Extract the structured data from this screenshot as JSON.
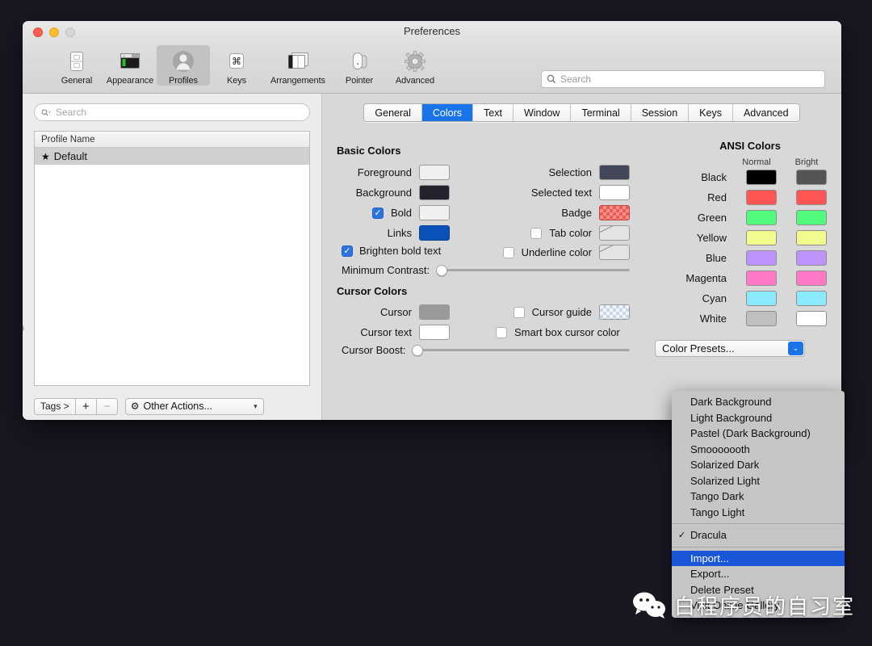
{
  "window": {
    "title": "Preferences",
    "traffic_lights": [
      "close",
      "minimize",
      "zoom-disabled"
    ]
  },
  "toolbar": {
    "items": [
      {
        "label": "General",
        "icon": "general-icon"
      },
      {
        "label": "Appearance",
        "icon": "appearance-icon"
      },
      {
        "label": "Profiles",
        "icon": "profiles-icon",
        "selected": true
      },
      {
        "label": "Keys",
        "icon": "keys-icon"
      },
      {
        "label": "Arrangements",
        "icon": "arrangements-icon"
      },
      {
        "label": "Pointer",
        "icon": "pointer-icon"
      },
      {
        "label": "Advanced",
        "icon": "advanced-icon"
      }
    ],
    "search_placeholder": "Search"
  },
  "sidebar": {
    "search_placeholder": "Search",
    "column_header": "Profile Name",
    "profiles": [
      {
        "name": "Default",
        "starred": true,
        "selected": true
      }
    ],
    "footer": {
      "tags_label": "Tags >",
      "add_label": "+",
      "remove_label": "−",
      "other_actions_label": "Other Actions...",
      "gear_icon": "gear-icon",
      "chevron_icon": "chevron-down-icon"
    }
  },
  "tabs": [
    {
      "label": "General",
      "active": false
    },
    {
      "label": "Colors",
      "active": true
    },
    {
      "label": "Text",
      "active": false
    },
    {
      "label": "Window",
      "active": false
    },
    {
      "label": "Terminal",
      "active": false
    },
    {
      "label": "Session",
      "active": false
    },
    {
      "label": "Keys",
      "active": false
    },
    {
      "label": "Advanced",
      "active": false
    }
  ],
  "basic_colors": {
    "title": "Basic Colors",
    "left": [
      {
        "label": "Foreground",
        "color": "#f0f0f0",
        "checkbox": null
      },
      {
        "label": "Background",
        "color": "#23222d",
        "checkbox": null
      },
      {
        "label": "Bold",
        "color": "#f0f0f0",
        "checkbox": true
      },
      {
        "label": "Links",
        "color": "#0b52b8",
        "checkbox": null
      }
    ],
    "right": [
      {
        "label": "Selection",
        "color": "#44475a",
        "checkbox": null
      },
      {
        "label": "Selected text",
        "color": "#ffffff",
        "checkbox": null
      },
      {
        "label": "Badge",
        "color": "#ff5555",
        "checkbox": null,
        "style": "badge"
      },
      {
        "label": "Tab color",
        "color": null,
        "checkbox": false,
        "style": "empty"
      }
    ],
    "brighten_bold_text": {
      "label": "Brighten bold text",
      "checked": true
    },
    "underline_color": {
      "label": "Underline color",
      "checked": false,
      "style": "empty"
    },
    "minimum_contrast": {
      "label": "Minimum Contrast:",
      "value": 0
    }
  },
  "cursor_colors": {
    "title": "Cursor Colors",
    "left": [
      {
        "label": "Cursor",
        "color": "#9a9a9a"
      },
      {
        "label": "Cursor text",
        "color": "#ffffff"
      }
    ],
    "right": [
      {
        "label": "Cursor guide",
        "checked": false,
        "style": "checker"
      },
      {
        "label": "Smart box cursor color",
        "checked": false
      }
    ],
    "cursor_boost": {
      "label": "Cursor Boost:",
      "value": 0
    }
  },
  "ansi_colors": {
    "title": "ANSI Colors",
    "columns": [
      "Normal",
      "Bright"
    ],
    "rows": [
      {
        "name": "Black",
        "normal": "#000000",
        "bright": "#555555"
      },
      {
        "name": "Red",
        "normal": "#ff5555",
        "bright": "#ff5555"
      },
      {
        "name": "Green",
        "normal": "#50fa7b",
        "bright": "#50fa7b"
      },
      {
        "name": "Yellow",
        "normal": "#f1fa8c",
        "bright": "#f1fa8c"
      },
      {
        "name": "Blue",
        "normal": "#bd93f9",
        "bright": "#bd93f9"
      },
      {
        "name": "Magenta",
        "normal": "#ff79c6",
        "bright": "#ff79c6"
      },
      {
        "name": "Cyan",
        "normal": "#8be9fd",
        "bright": "#8be9fd"
      },
      {
        "name": "White",
        "normal": "#bfbfbf",
        "bright": "#ffffff"
      }
    ]
  },
  "color_presets": {
    "button_label": "Color Presets...",
    "menu_items": [
      {
        "label": "Dark Background",
        "checked": false,
        "highlighted": false
      },
      {
        "label": "Light Background",
        "checked": false,
        "highlighted": false
      },
      {
        "label": "Pastel (Dark Background)",
        "checked": false,
        "highlighted": false
      },
      {
        "label": "Smooooooth",
        "checked": false,
        "highlighted": false
      },
      {
        "label": "Solarized Dark",
        "checked": false,
        "highlighted": false
      },
      {
        "label": "Solarized Light",
        "checked": false,
        "highlighted": false
      },
      {
        "label": "Tango Dark",
        "checked": false,
        "highlighted": false
      },
      {
        "label": "Tango Light",
        "checked": false,
        "highlighted": false
      },
      {
        "separator": true
      },
      {
        "label": "Dracula",
        "checked": true,
        "highlighted": false
      },
      {
        "separator": true
      },
      {
        "label": "Import...",
        "checked": false,
        "highlighted": true
      },
      {
        "label": "Export...",
        "checked": false,
        "highlighted": false
      },
      {
        "label": "Delete Preset",
        "checked": false,
        "highlighted": false
      },
      {
        "label": "Visit Online Gallery",
        "checked": false,
        "highlighted": false
      }
    ],
    "checkmark": "✓"
  },
  "watermark": {
    "text": "白程序员的自习室",
    "icon": "wechat-icon"
  },
  "theme": {
    "accent": "#1874e8",
    "menu_highlight": "#1a56d8",
    "window_bg": "#ececec",
    "pane_bg": "#d8d8d8",
    "desktop_bg": "#191722"
  }
}
